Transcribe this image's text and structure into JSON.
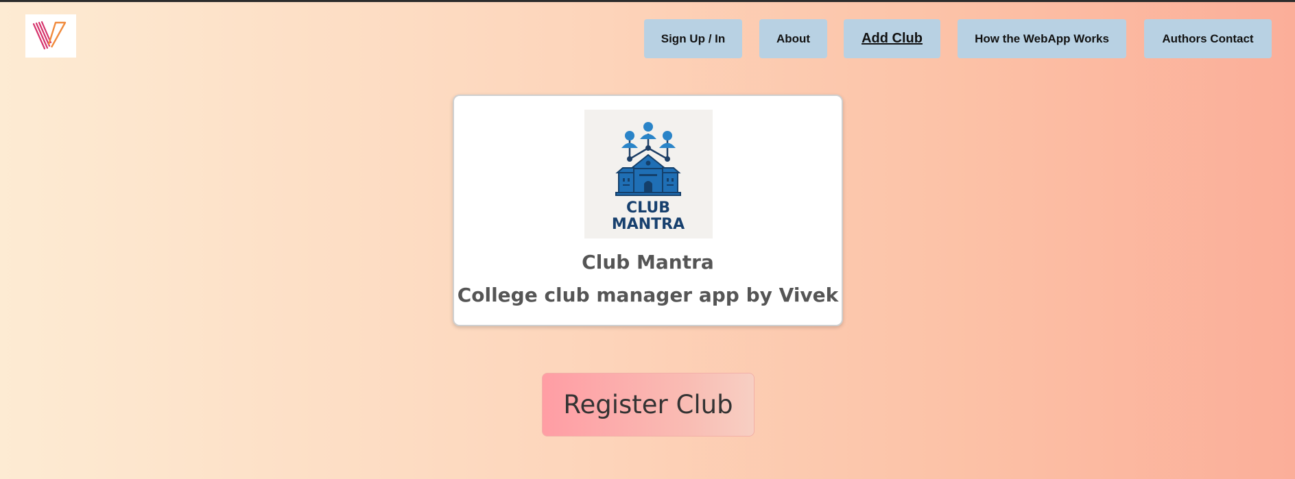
{
  "header": {
    "logo_icon": "v-brand-logo-icon",
    "nav": [
      {
        "id": "signup",
        "label": "Sign Up / In"
      },
      {
        "id": "about",
        "label": "About"
      },
      {
        "id": "add",
        "label": "Add Club",
        "active": true
      },
      {
        "id": "how",
        "label": "How the WebApp Works"
      },
      {
        "id": "contact",
        "label": "Authors Contact"
      }
    ]
  },
  "card": {
    "image_icon": "club-mantra-logo-icon",
    "image_text_line1": "CLUB",
    "image_text_line2": "MANTRA",
    "title": "Club Mantra",
    "subtitle": "College club manager app by Vivek"
  },
  "register_button": "Register Club",
  "colors": {
    "nav_button_bg": "#b8d1e3",
    "brand_blue": "#1f6fb5",
    "text_gray": "#555555",
    "register_start": "#ff9da4",
    "register_end": "#f7cfc3"
  }
}
